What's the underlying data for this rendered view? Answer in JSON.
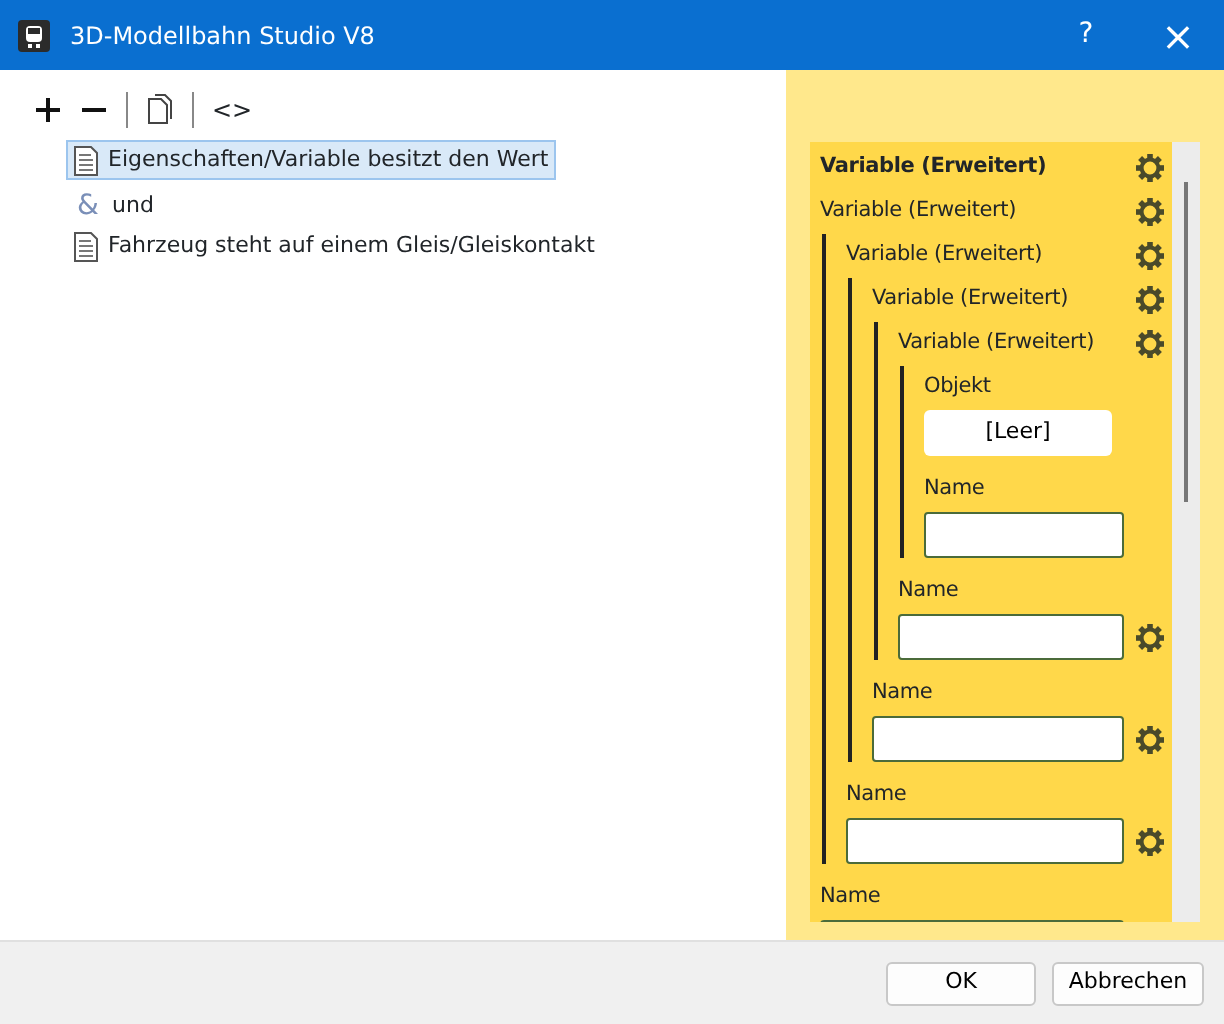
{
  "window": {
    "title": "3D-Modellbahn Studio V8",
    "help": "?",
    "close": "×"
  },
  "toolbar": {
    "code_toggle": "<>"
  },
  "tree": [
    {
      "kind": "document",
      "label": "Eigenschaften/Variable besitzt den Wert",
      "selected": true
    },
    {
      "kind": "operator",
      "symbol": "&",
      "label": "und",
      "selected": false
    },
    {
      "kind": "document",
      "label": "Fahrzeug steht auf einem Gleis/Gleiskontakt",
      "selected": false
    }
  ],
  "panel": {
    "title": "Variable (Erweitert)",
    "content": [
      {
        "kind": "block",
        "title": "Variable (Erweitert)",
        "content": [
          {
            "kind": "block",
            "title": "Variable (Erweitert)",
            "content": [
              {
                "kind": "block",
                "title": "Variable (Erweitert)",
                "content": [
                  {
                    "kind": "block",
                    "title": "Variable (Erweitert)",
                    "content": [
                      {
                        "kind": "button",
                        "label": "Objekt",
                        "value": "[Leer]"
                      },
                      {
                        "kind": "field",
                        "label": "Name",
                        "gear": false
                      }
                    ]
                  },
                  {
                    "kind": "field",
                    "label": "Name",
                    "gear": true
                  }
                ]
              },
              {
                "kind": "field",
                "label": "Name",
                "gear": true
              }
            ]
          },
          {
            "kind": "field",
            "label": "Name",
            "gear": true
          }
        ]
      },
      {
        "kind": "field",
        "label": "Name",
        "gear": false
      }
    ]
  },
  "buttons": [
    {
      "label": "OK"
    },
    {
      "label": "Abbrechen"
    }
  ]
}
